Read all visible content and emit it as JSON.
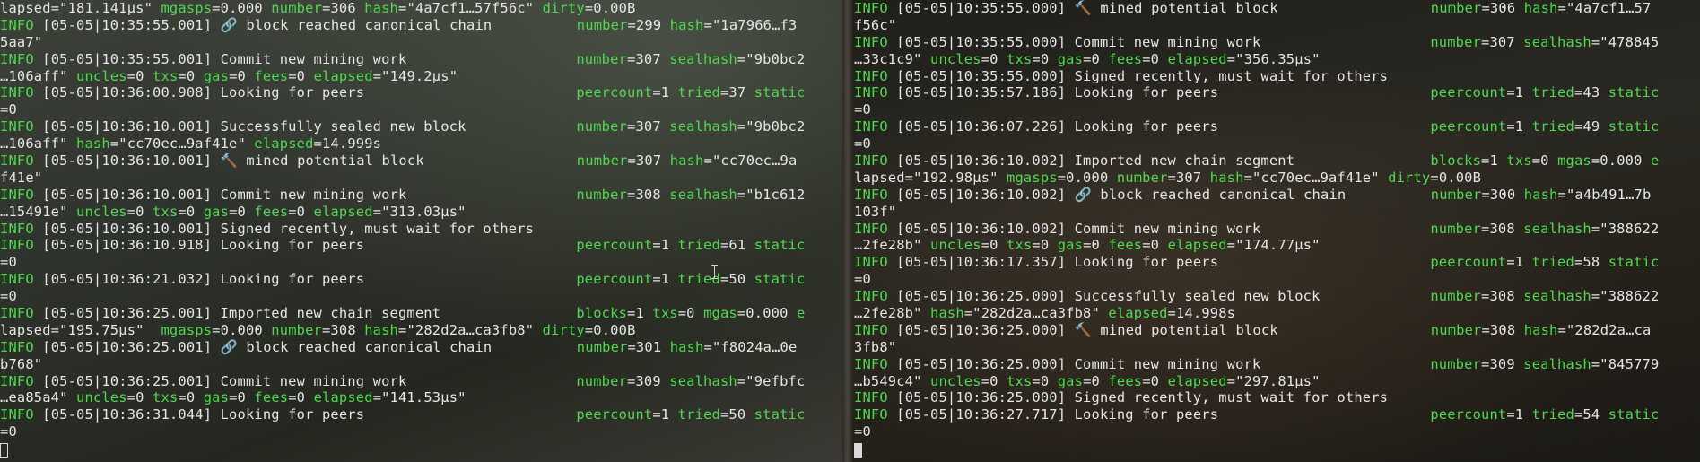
{
  "left": {
    "lines": [
      [
        [
          "lapsed=\"181.141µs\" ",
          "c-val"
        ],
        [
          "mgasps",
          "c-key"
        ],
        [
          "=0.000 ",
          "c-val"
        ],
        [
          "number",
          "c-key"
        ],
        [
          "=306 ",
          "c-val"
        ],
        [
          "hash",
          "c-key"
        ],
        [
          "=\"4a7cf1…57f56c\" ",
          "c-val"
        ],
        [
          "dirty",
          "c-key"
        ],
        [
          "=0.00B",
          "c-val"
        ]
      ],
      [
        [
          "INFO",
          "c-key"
        ],
        [
          " [05-05|10:35:55.001] 🔗 block reached canonical chain          ",
          "c-label"
        ],
        [
          "number",
          "c-key"
        ],
        [
          "=299 ",
          "c-val"
        ],
        [
          "hash",
          "c-key"
        ],
        [
          "=\"1a7966…f3",
          "c-val"
        ]
      ],
      [
        [
          "5aa7\"",
          "c-val"
        ]
      ],
      [
        [
          "INFO",
          "c-key"
        ],
        [
          " [05-05|10:35:55.001] Commit new mining work                    ",
          "c-label"
        ],
        [
          "number",
          "c-key"
        ],
        [
          "=307 ",
          "c-val"
        ],
        [
          "sealhash",
          "c-key"
        ],
        [
          "=\"9b0bc2",
          "c-val"
        ]
      ],
      [
        [
          "…106aff\" ",
          "c-val"
        ],
        [
          "uncles",
          "c-key"
        ],
        [
          "=0 ",
          "c-val"
        ],
        [
          "txs",
          "c-key"
        ],
        [
          "=0 ",
          "c-val"
        ],
        [
          "gas",
          "c-key"
        ],
        [
          "=0 ",
          "c-val"
        ],
        [
          "fees",
          "c-key"
        ],
        [
          "=0 ",
          "c-val"
        ],
        [
          "elapsed",
          "c-key"
        ],
        [
          "=\"149.2µs\"",
          "c-val"
        ]
      ],
      [
        [
          "INFO",
          "c-key"
        ],
        [
          " [05-05|10:36:00.908] Looking for peers                         ",
          "c-label"
        ],
        [
          "peercount",
          "c-key"
        ],
        [
          "=1 ",
          "c-val"
        ],
        [
          "tried",
          "c-key"
        ],
        [
          "=37 ",
          "c-val"
        ],
        [
          "static",
          "c-key"
        ]
      ],
      [
        [
          "=0",
          "c-val"
        ]
      ],
      [
        [
          "INFO",
          "c-key"
        ],
        [
          " [05-05|10:36:10.001] Successfully sealed new block             ",
          "c-label"
        ],
        [
          "number",
          "c-key"
        ],
        [
          "=307 ",
          "c-val"
        ],
        [
          "sealhash",
          "c-key"
        ],
        [
          "=\"9b0bc2",
          "c-val"
        ]
      ],
      [
        [
          "…106aff\" ",
          "c-val"
        ],
        [
          "hash",
          "c-key"
        ],
        [
          "=\"cc70ec…9af41e\" ",
          "c-val"
        ],
        [
          "elapsed",
          "c-key"
        ],
        [
          "=14.999s",
          "c-val"
        ]
      ],
      [
        [
          "INFO",
          "c-key"
        ],
        [
          " [05-05|10:36:10.001] 🔨 mined potential block                  ",
          "c-label"
        ],
        [
          "number",
          "c-key"
        ],
        [
          "=307 ",
          "c-val"
        ],
        [
          "hash",
          "c-key"
        ],
        [
          "=\"cc70ec…9a",
          "c-val"
        ]
      ],
      [
        [
          "f41e\"",
          "c-val"
        ]
      ],
      [
        [
          "INFO",
          "c-key"
        ],
        [
          " [05-05|10:36:10.001] Commit new mining work                    ",
          "c-label"
        ],
        [
          "number",
          "c-key"
        ],
        [
          "=308 ",
          "c-val"
        ],
        [
          "sealhash",
          "c-key"
        ],
        [
          "=\"b1c612",
          "c-val"
        ]
      ],
      [
        [
          "…15491e\" ",
          "c-val"
        ],
        [
          "uncles",
          "c-key"
        ],
        [
          "=0 ",
          "c-val"
        ],
        [
          "txs",
          "c-key"
        ],
        [
          "=0 ",
          "c-val"
        ],
        [
          "gas",
          "c-key"
        ],
        [
          "=0 ",
          "c-val"
        ],
        [
          "fees",
          "c-key"
        ],
        [
          "=0 ",
          "c-val"
        ],
        [
          "elapsed",
          "c-key"
        ],
        [
          "=\"313.03µs\"",
          "c-val"
        ]
      ],
      [
        [
          "INFO",
          "c-key"
        ],
        [
          " [05-05|10:36:10.001] Signed recently, must wait for others",
          "c-label"
        ]
      ],
      [
        [
          "INFO",
          "c-key"
        ],
        [
          " [05-05|10:36:10.918] Looking for peers                         ",
          "c-label"
        ],
        [
          "peercount",
          "c-key"
        ],
        [
          "=1 ",
          "c-val"
        ],
        [
          "tried",
          "c-key"
        ],
        [
          "=61 ",
          "c-val"
        ],
        [
          "static",
          "c-key"
        ]
      ],
      [
        [
          "=0",
          "c-val"
        ]
      ],
      [
        [
          "INFO",
          "c-key"
        ],
        [
          " [05-05|10:36:21.032] Looking for peers                         ",
          "c-label"
        ],
        [
          "peercount",
          "c-key"
        ],
        [
          "=1 ",
          "c-val"
        ],
        [
          "tried",
          "c-key"
        ],
        [
          "=50 ",
          "c-val"
        ],
        [
          "static",
          "c-key"
        ]
      ],
      [
        [
          "=0",
          "c-val"
        ]
      ],
      [
        [
          "INFO",
          "c-key"
        ],
        [
          " [05-05|10:36:25.001] Imported new chain segment                ",
          "c-label"
        ],
        [
          "blocks",
          "c-key"
        ],
        [
          "=1 ",
          "c-val"
        ],
        [
          "txs",
          "c-key"
        ],
        [
          "=0 ",
          "c-val"
        ],
        [
          "mgas",
          "c-key"
        ],
        [
          "=0.000 ",
          "c-val"
        ],
        [
          "e",
          "c-key"
        ]
      ],
      [
        [
          "lapsed=\"195.75µs\"  ",
          "c-val"
        ],
        [
          "mgasps",
          "c-key"
        ],
        [
          "=0.000 ",
          "c-val"
        ],
        [
          "number",
          "c-key"
        ],
        [
          "=308 ",
          "c-val"
        ],
        [
          "hash",
          "c-key"
        ],
        [
          "=\"282d2a…ca3fb8\" ",
          "c-val"
        ],
        [
          "dirty",
          "c-key"
        ],
        [
          "=0.00B",
          "c-val"
        ]
      ],
      [
        [
          "INFO",
          "c-key"
        ],
        [
          " [05-05|10:36:25.001] 🔗 block reached canonical chain          ",
          "c-label"
        ],
        [
          "number",
          "c-key"
        ],
        [
          "=301 ",
          "c-val"
        ],
        [
          "hash",
          "c-key"
        ],
        [
          "=\"f8024a…0e",
          "c-val"
        ]
      ],
      [
        [
          "b768\"",
          "c-val"
        ]
      ],
      [
        [
          "INFO",
          "c-key"
        ],
        [
          " [05-05|10:36:25.001] Commit new mining work                    ",
          "c-label"
        ],
        [
          "number",
          "c-key"
        ],
        [
          "=309 ",
          "c-val"
        ],
        [
          "sealhash",
          "c-key"
        ],
        [
          "=\"9efbfc",
          "c-val"
        ]
      ],
      [
        [
          "…ea85a4\" ",
          "c-val"
        ],
        [
          "uncles",
          "c-key"
        ],
        [
          "=0 ",
          "c-val"
        ],
        [
          "txs",
          "c-key"
        ],
        [
          "=0 ",
          "c-val"
        ],
        [
          "gas",
          "c-key"
        ],
        [
          "=0 ",
          "c-val"
        ],
        [
          "fees",
          "c-key"
        ],
        [
          "=0 ",
          "c-val"
        ],
        [
          "elapsed",
          "c-key"
        ],
        [
          "=\"141.53µs\"",
          "c-val"
        ]
      ],
      [
        [
          "INFO",
          "c-key"
        ],
        [
          " [05-05|10:36:31.044] Looking for peers                         ",
          "c-label"
        ],
        [
          "peercount",
          "c-key"
        ],
        [
          "=1 ",
          "c-val"
        ],
        [
          "tried",
          "c-key"
        ],
        [
          "=50 ",
          "c-val"
        ],
        [
          "static",
          "c-key"
        ]
      ],
      [
        [
          "=0",
          "c-val"
        ]
      ]
    ]
  },
  "right": {
    "lines": [
      [
        [
          "INFO",
          "c-key"
        ],
        [
          " [05-05|10:35:55.000] 🔨 mined potential block                  ",
          "c-label"
        ],
        [
          "number",
          "c-key"
        ],
        [
          "=306 ",
          "c-val"
        ],
        [
          "hash",
          "c-key"
        ],
        [
          "=\"4a7cf1…57",
          "c-val"
        ]
      ],
      [
        [
          "f56c\"",
          "c-val"
        ]
      ],
      [
        [
          "INFO",
          "c-key"
        ],
        [
          " [05-05|10:35:55.000] Commit new mining work                    ",
          "c-label"
        ],
        [
          "number",
          "c-key"
        ],
        [
          "=307 ",
          "c-val"
        ],
        [
          "sealhash",
          "c-key"
        ],
        [
          "=\"478845",
          "c-val"
        ]
      ],
      [
        [
          "…33c1c9\" ",
          "c-val"
        ],
        [
          "uncles",
          "c-key"
        ],
        [
          "=0 ",
          "c-val"
        ],
        [
          "txs",
          "c-key"
        ],
        [
          "=0 ",
          "c-val"
        ],
        [
          "gas",
          "c-key"
        ],
        [
          "=0 ",
          "c-val"
        ],
        [
          "fees",
          "c-key"
        ],
        [
          "=0 ",
          "c-val"
        ],
        [
          "elapsed",
          "c-key"
        ],
        [
          "=\"356.35µs\"",
          "c-val"
        ]
      ],
      [
        [
          "INFO",
          "c-key"
        ],
        [
          " [05-05|10:35:55.000] Signed recently, must wait for others",
          "c-label"
        ]
      ],
      [
        [
          "INFO",
          "c-key"
        ],
        [
          " [05-05|10:35:57.186] Looking for peers                         ",
          "c-label"
        ],
        [
          "peercount",
          "c-key"
        ],
        [
          "=1 ",
          "c-val"
        ],
        [
          "tried",
          "c-key"
        ],
        [
          "=43 ",
          "c-val"
        ],
        [
          "static",
          "c-key"
        ]
      ],
      [
        [
          "=0",
          "c-val"
        ]
      ],
      [
        [
          "INFO",
          "c-key"
        ],
        [
          " [05-05|10:36:07.226] Looking for peers                         ",
          "c-label"
        ],
        [
          "peercount",
          "c-key"
        ],
        [
          "=1 ",
          "c-val"
        ],
        [
          "tried",
          "c-key"
        ],
        [
          "=49 ",
          "c-val"
        ],
        [
          "static",
          "c-key"
        ]
      ],
      [
        [
          "=0",
          "c-val"
        ]
      ],
      [
        [
          "INFO",
          "c-key"
        ],
        [
          " [05-05|10:36:10.002] Imported new chain segment                ",
          "c-label"
        ],
        [
          "blocks",
          "c-key"
        ],
        [
          "=1 ",
          "c-val"
        ],
        [
          "txs",
          "c-key"
        ],
        [
          "=0 ",
          "c-val"
        ],
        [
          "mgas",
          "c-key"
        ],
        [
          "=0.000 ",
          "c-val"
        ],
        [
          "e",
          "c-key"
        ]
      ],
      [
        [
          "lapsed=\"192.98µs\" ",
          "c-val"
        ],
        [
          "mgasps",
          "c-key"
        ],
        [
          "=0.000 ",
          "c-val"
        ],
        [
          "number",
          "c-key"
        ],
        [
          "=307 ",
          "c-val"
        ],
        [
          "hash",
          "c-key"
        ],
        [
          "=\"cc70ec…9af41e\" ",
          "c-val"
        ],
        [
          "dirty",
          "c-key"
        ],
        [
          "=0.00B",
          "c-val"
        ]
      ],
      [
        [
          "INFO",
          "c-key"
        ],
        [
          " [05-05|10:36:10.002] 🔗 block reached canonical chain          ",
          "c-label"
        ],
        [
          "number",
          "c-key"
        ],
        [
          "=300 ",
          "c-val"
        ],
        [
          "hash",
          "c-key"
        ],
        [
          "=\"a4b491…7b",
          "c-val"
        ]
      ],
      [
        [
          "103f\"",
          "c-val"
        ]
      ],
      [
        [
          "INFO",
          "c-key"
        ],
        [
          " [05-05|10:36:10.002] Commit new mining work                    ",
          "c-label"
        ],
        [
          "number",
          "c-key"
        ],
        [
          "=308 ",
          "c-val"
        ],
        [
          "sealhash",
          "c-key"
        ],
        [
          "=\"388622",
          "c-val"
        ]
      ],
      [
        [
          "…2fe28b\" ",
          "c-val"
        ],
        [
          "uncles",
          "c-key"
        ],
        [
          "=0 ",
          "c-val"
        ],
        [
          "txs",
          "c-key"
        ],
        [
          "=0 ",
          "c-val"
        ],
        [
          "gas",
          "c-key"
        ],
        [
          "=0 ",
          "c-val"
        ],
        [
          "fees",
          "c-key"
        ],
        [
          "=0 ",
          "c-val"
        ],
        [
          "elapsed",
          "c-key"
        ],
        [
          "=\"174.77µs\"",
          "c-val"
        ]
      ],
      [
        [
          "INFO",
          "c-key"
        ],
        [
          " [05-05|10:36:17.357] Looking for peers                         ",
          "c-label"
        ],
        [
          "peercount",
          "c-key"
        ],
        [
          "=1 ",
          "c-val"
        ],
        [
          "tried",
          "c-key"
        ],
        [
          "=58 ",
          "c-val"
        ],
        [
          "static",
          "c-key"
        ]
      ],
      [
        [
          "=0",
          "c-val"
        ]
      ],
      [
        [
          "INFO",
          "c-key"
        ],
        [
          " [05-05|10:36:25.000] Successfully sealed new block             ",
          "c-label"
        ],
        [
          "number",
          "c-key"
        ],
        [
          "=308 ",
          "c-val"
        ],
        [
          "sealhash",
          "c-key"
        ],
        [
          "=\"388622",
          "c-val"
        ]
      ],
      [
        [
          "…2fe28b\" ",
          "c-val"
        ],
        [
          "hash",
          "c-key"
        ],
        [
          "=\"282d2a…ca3fb8\" ",
          "c-val"
        ],
        [
          "elapsed",
          "c-key"
        ],
        [
          "=14.998s",
          "c-val"
        ]
      ],
      [
        [
          "INFO",
          "c-key"
        ],
        [
          " [05-05|10:36:25.000] 🔨 mined potential block                  ",
          "c-label"
        ],
        [
          "number",
          "c-key"
        ],
        [
          "=308 ",
          "c-val"
        ],
        [
          "hash",
          "c-key"
        ],
        [
          "=\"282d2a…ca",
          "c-val"
        ]
      ],
      [
        [
          "3fb8\"",
          "c-val"
        ]
      ],
      [
        [
          "INFO",
          "c-key"
        ],
        [
          " [05-05|10:36:25.000] Commit new mining work                    ",
          "c-label"
        ],
        [
          "number",
          "c-key"
        ],
        [
          "=309 ",
          "c-val"
        ],
        [
          "sealhash",
          "c-key"
        ],
        [
          "=\"845779",
          "c-val"
        ]
      ],
      [
        [
          "…b549c4\" ",
          "c-val"
        ],
        [
          "uncles",
          "c-key"
        ],
        [
          "=0 ",
          "c-val"
        ],
        [
          "txs",
          "c-key"
        ],
        [
          "=0 ",
          "c-val"
        ],
        [
          "gas",
          "c-key"
        ],
        [
          "=0 ",
          "c-val"
        ],
        [
          "fees",
          "c-key"
        ],
        [
          "=0 ",
          "c-val"
        ],
        [
          "elapsed",
          "c-key"
        ],
        [
          "=\"297.81µs\"",
          "c-val"
        ]
      ],
      [
        [
          "INFO",
          "c-key"
        ],
        [
          " [05-05|10:36:25.000] Signed recently, must wait for others",
          "c-label"
        ]
      ],
      [
        [
          "INFO",
          "c-key"
        ],
        [
          " [05-05|10:36:27.717] Looking for peers                         ",
          "c-label"
        ],
        [
          "peercount",
          "c-key"
        ],
        [
          "=1 ",
          "c-val"
        ],
        [
          "tried",
          "c-key"
        ],
        [
          "=54 ",
          "c-val"
        ],
        [
          "static",
          "c-key"
        ]
      ],
      [
        [
          "=0",
          "c-val"
        ]
      ]
    ]
  },
  "colors": {
    "text": "#e6e6e6",
    "key": "#4fd94f"
  }
}
